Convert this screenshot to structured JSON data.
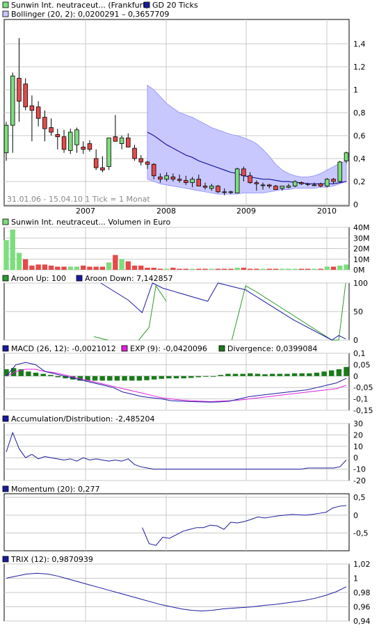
{
  "colors": {
    "up": "#7ddd7d",
    "down": "#e64a4a",
    "band": "#c8c8ff",
    "band_edge": "#8c8cff",
    "sma": "#1a1aa0",
    "aroon_up": "#2a9a2a",
    "aroon_down": "#1a1aa0",
    "macd": "#1a1aa0",
    "exp": "#dd22dd",
    "divergence": "#1a7a1a",
    "line": "#1a1aa0"
  },
  "legend": {
    "price_series": "Sunwin Int. neutraceut... (Frankfurt)",
    "gd": "GD 20 Ticks",
    "bollinger": "Bollinger (20, 2): 0,0200291 – 0,3657709",
    "date_info": "31.01.06 - 15.04.10   1 Tick = 1 Monat",
    "volume": "Sunwin Int. neutraceut... Volumen in Euro",
    "aroon_up": "Aroon Up: 100",
    "aroon_down": "Aroon Down: 7,142857",
    "macd": "MACD (26, 12): -0,0021012",
    "exp": "EXP (9): -0,0420096",
    "divergence": "Divergence: 0,0399084",
    "ad": "Accumulation/Distribution: -2,485204",
    "momentum": "Momentum (20): 0,277",
    "trix": "TRIX (12): 0,9870939"
  },
  "chart_data": [
    {
      "type": "candlestick",
      "x_tick_labels": [
        "2007",
        "2008",
        "2009",
        "2010"
      ],
      "y_tick_labels": [
        "0",
        "0,2",
        "0,4",
        "0,6",
        "0,8",
        "1",
        "1,2",
        "1,4"
      ],
      "ylim": [
        0,
        1.6
      ],
      "ohlc": [
        [
          0.45,
          0.72,
          0.38,
          0.69
        ],
        [
          0.69,
          1.15,
          0.45,
          1.12
        ],
        [
          1.1,
          1.45,
          0.72,
          0.9
        ],
        [
          1.05,
          1.1,
          0.82,
          0.85
        ],
        [
          0.86,
          0.95,
          0.55,
          0.82
        ],
        [
          0.85,
          0.9,
          0.68,
          0.75
        ],
        [
          0.76,
          0.82,
          0.55,
          0.66
        ],
        [
          0.67,
          0.75,
          0.6,
          0.63
        ],
        [
          0.61,
          0.66,
          0.48,
          0.59
        ],
        [
          0.59,
          0.65,
          0.45,
          0.48
        ],
        [
          0.47,
          0.66,
          0.44,
          0.63
        ],
        [
          0.52,
          0.67,
          0.45,
          0.65
        ],
        [
          0.5,
          0.55,
          0.44,
          0.48
        ],
        [
          0.53,
          0.56,
          0.46,
          0.48
        ],
        [
          0.4,
          0.48,
          0.3,
          0.32
        ],
        [
          0.32,
          0.42,
          0.28,
          0.3
        ],
        [
          0.33,
          0.58,
          0.3,
          0.58
        ],
        [
          0.59,
          0.78,
          0.55,
          0.55
        ],
        [
          0.53,
          0.6,
          0.48,
          0.58
        ],
        [
          0.58,
          0.62,
          0.5,
          0.5
        ],
        [
          0.49,
          0.52,
          0.38,
          0.4
        ],
        [
          0.4,
          0.43,
          0.34,
          0.37
        ],
        [
          0.37,
          0.38,
          0.31,
          0.35
        ],
        [
          0.35,
          0.36,
          0.22,
          0.25
        ],
        [
          0.24,
          0.27,
          0.19,
          0.22
        ],
        [
          0.22,
          0.28,
          0.2,
          0.25
        ],
        [
          0.24,
          0.27,
          0.2,
          0.22
        ],
        [
          0.22,
          0.26,
          0.19,
          0.21
        ],
        [
          0.21,
          0.25,
          0.17,
          0.19
        ],
        [
          0.19,
          0.24,
          0.15,
          0.22
        ],
        [
          0.22,
          0.26,
          0.16,
          0.16
        ],
        [
          0.16,
          0.19,
          0.13,
          0.15
        ],
        [
          0.14,
          0.18,
          0.12,
          0.16
        ],
        [
          0.16,
          0.17,
          0.1,
          0.11
        ],
        [
          0.11,
          0.14,
          0.08,
          0.11
        ],
        [
          0.11,
          0.12,
          0.09,
          0.11
        ],
        [
          0.1,
          0.32,
          0.1,
          0.31
        ],
        [
          0.31,
          0.33,
          0.2,
          0.25
        ],
        [
          0.25,
          0.28,
          0.18,
          0.19
        ],
        [
          0.19,
          0.21,
          0.12,
          0.18
        ],
        [
          0.17,
          0.19,
          0.13,
          0.17
        ],
        [
          0.17,
          0.18,
          0.14,
          0.16
        ],
        [
          0.16,
          0.17,
          0.13,
          0.13
        ],
        [
          0.14,
          0.16,
          0.12,
          0.16
        ],
        [
          0.15,
          0.18,
          0.14,
          0.16
        ],
        [
          0.16,
          0.21,
          0.15,
          0.2
        ],
        [
          0.19,
          0.2,
          0.17,
          0.18
        ],
        [
          0.18,
          0.19,
          0.16,
          0.18
        ],
        [
          0.17,
          0.19,
          0.16,
          0.17
        ],
        [
          0.18,
          0.19,
          0.15,
          0.16
        ],
        [
          0.16,
          0.23,
          0.15,
          0.22
        ],
        [
          0.22,
          0.23,
          0.18,
          0.2
        ],
        [
          0.2,
          0.38,
          0.19,
          0.37
        ],
        [
          0.38,
          0.46,
          0.36,
          0.45
        ]
      ],
      "bollinger_upper": [
        1.04,
        1.0,
        0.94,
        0.88,
        0.84,
        0.8,
        0.78,
        0.76,
        0.73,
        0.7,
        0.67,
        0.65,
        0.63,
        0.61,
        0.6,
        0.58,
        0.56,
        0.53,
        0.48,
        0.42,
        0.35,
        0.3,
        0.27,
        0.25,
        0.24,
        0.24,
        0.25,
        0.27,
        0.3,
        0.33,
        0.36,
        0.38
      ],
      "bollinger_lower": [
        0.22,
        0.2,
        0.18,
        0.17,
        0.16,
        0.15,
        0.14,
        0.13,
        0.12,
        0.11,
        0.1,
        0.09,
        0.09,
        0.09,
        0.09,
        0.1,
        0.1,
        0.1,
        0.1,
        0.11,
        0.12,
        0.13,
        0.13,
        0.14,
        0.14,
        0.14,
        0.14,
        0.15,
        0.15,
        0.16,
        0.18,
        0.2
      ],
      "gd20": [
        0.63,
        0.6,
        0.56,
        0.52,
        0.49,
        0.46,
        0.43,
        0.41,
        0.38,
        0.36,
        0.34,
        0.32,
        0.3,
        0.28,
        0.27,
        0.25,
        0.24,
        0.23,
        0.22,
        0.22,
        0.21,
        0.2,
        0.2,
        0.19,
        0.19,
        0.18,
        0.18,
        0.18,
        0.18,
        0.18,
        0.19,
        0.2
      ]
    },
    {
      "type": "bar",
      "title": "Volumen in Euro",
      "y_tick_labels": [
        "0M",
        "10M",
        "20M",
        "30M",
        "40M"
      ],
      "ylim": [
        0,
        40
      ],
      "values": [
        28,
        38,
        16,
        10,
        4,
        5,
        5,
        4,
        3,
        3,
        3,
        3,
        4,
        3,
        3,
        3,
        7,
        14,
        10,
        8,
        4,
        4,
        2,
        2,
        1,
        1,
        2,
        1,
        1,
        1,
        1,
        1,
        1,
        1,
        1,
        1,
        2,
        2,
        1,
        1,
        1,
        1,
        1,
        1,
        1,
        1,
        1,
        1,
        1,
        1,
        3,
        3,
        4,
        5
      ],
      "up": [
        1,
        1,
        1,
        0,
        0,
        0,
        0,
        0,
        0,
        0,
        1,
        1,
        0,
        0,
        0,
        0,
        1,
        0,
        1,
        0,
        0,
        0,
        0,
        0,
        0,
        1,
        0,
        0,
        0,
        1,
        0,
        0,
        1,
        0,
        0,
        0,
        1,
        0,
        0,
        0,
        1,
        0,
        0,
        1,
        1,
        1,
        0,
        0,
        1,
        0,
        1,
        0,
        1,
        1
      ]
    },
    {
      "type": "line",
      "series": [
        {
          "name": "Aroon Up"
        },
        {
          "name": "Aroon Down"
        }
      ],
      "y_tick_labels": [
        "0",
        "50",
        "100"
      ],
      "ylim": [
        0,
        100
      ],
      "aroon_up": [
        [
          0.26,
          6
        ],
        [
          0.3,
          0
        ],
        [
          0.36,
          null
        ],
        [
          0.39,
          0
        ],
        [
          0.42,
          22
        ],
        [
          0.44,
          95
        ],
        [
          0.47,
          68
        ],
        [
          0.6,
          null
        ],
        [
          0.66,
          0
        ],
        [
          0.7,
          95
        ],
        [
          0.73,
          85
        ],
        [
          0.95,
          0
        ],
        [
          0.97,
          0
        ],
        [
          0.99,
          100
        ]
      ],
      "aroon_down": [
        [
          0.28,
          100
        ],
        [
          0.36,
          70
        ],
        [
          0.4,
          48
        ],
        [
          0.43,
          100
        ],
        [
          0.46,
          91
        ],
        [
          0.59,
          68
        ],
        [
          0.62,
          100
        ],
        [
          0.7,
          88
        ],
        [
          0.84,
          35
        ],
        [
          0.95,
          0
        ],
        [
          0.97,
          8
        ],
        [
          0.99,
          2
        ]
      ]
    },
    {
      "type": "line",
      "series": [
        {
          "name": "MACD"
        },
        {
          "name": "EXP"
        },
        {
          "name": "Divergence"
        }
      ],
      "y_tick_labels": [
        "-0,15",
        "-0,1",
        "-0,05",
        "0",
        "0,05",
        "0,1"
      ],
      "ylim": [
        -0.15,
        0.1
      ],
      "macd": [
        0.0,
        0.05,
        0.06,
        0.05,
        0.02,
        0.01,
        0.0,
        -0.01,
        -0.02,
        -0.03,
        -0.04,
        -0.05,
        -0.07,
        -0.08,
        -0.09,
        -0.095,
        -0.1,
        -0.108,
        -0.11,
        -0.112,
        -0.113,
        -0.114,
        -0.113,
        -0.11,
        -0.1,
        -0.09,
        -0.085,
        -0.08,
        -0.075,
        -0.07,
        -0.065,
        -0.06,
        -0.05,
        -0.04,
        -0.03,
        -0.01
      ],
      "exp": [
        0.0,
        0.02,
        0.03,
        0.03,
        0.02,
        0.015,
        0.005,
        -0.005,
        -0.015,
        -0.025,
        -0.035,
        -0.045,
        -0.055,
        -0.065,
        -0.075,
        -0.085,
        -0.095,
        -0.1,
        -0.105,
        -0.108,
        -0.11,
        -0.112,
        -0.11,
        -0.108,
        -0.105,
        -0.1,
        -0.095,
        -0.09,
        -0.085,
        -0.08,
        -0.075,
        -0.07,
        -0.065,
        -0.06,
        -0.055,
        -0.04
      ],
      "divergence": [
        0.03,
        0.035,
        0.03,
        0.02,
        0.015,
        0.01,
        0.005,
        -0.005,
        -0.01,
        -0.015,
        -0.02,
        -0.02,
        -0.02,
        -0.02,
        -0.02,
        -0.02,
        -0.02,
        -0.02,
        -0.02,
        -0.018,
        -0.015,
        -0.012,
        -0.01,
        -0.01,
        -0.01,
        -0.008,
        -0.005,
        -0.003,
        0.0,
        0.005,
        0.01,
        0.01,
        0.01,
        0.012,
        0.01,
        0.008,
        0.01,
        0.01,
        0.01,
        0.012,
        0.012,
        0.012,
        0.015,
        0.02,
        0.025,
        0.03,
        0.04
      ]
    },
    {
      "type": "line",
      "series": [
        {
          "name": "Accumulation/Distribution"
        }
      ],
      "y_tick_labels": [
        "-20",
        "-10",
        "0",
        "10",
        "20",
        "30"
      ],
      "ylim": [
        -20,
        30
      ],
      "values": [
        5,
        22,
        8,
        0,
        3,
        -1,
        1,
        0,
        -1,
        -2,
        -1,
        -3,
        0,
        -2,
        -1,
        -2,
        -3,
        -2,
        -3,
        -1,
        -6,
        -8,
        -9,
        -10,
        -10,
        -10,
        -10,
        -10,
        -10,
        -10,
        -10,
        -10,
        -10,
        -10,
        -10,
        -10,
        -10,
        -10,
        -10,
        -10,
        -10,
        -10,
        -10,
        -10,
        -10,
        -10,
        -10,
        -9,
        -9,
        -9,
        -9,
        -9,
        -8,
        -2
      ]
    },
    {
      "type": "line",
      "series": [
        {
          "name": "Momentum"
        }
      ],
      "y_tick_labels": [
        "-0,5",
        "0",
        "0,5"
      ],
      "ylim": [
        -1.0,
        0.6
      ],
      "values": [
        null,
        null,
        null,
        null,
        null,
        null,
        null,
        null,
        null,
        null,
        null,
        null,
        null,
        null,
        null,
        null,
        null,
        null,
        null,
        null,
        -0.35,
        -0.8,
        -0.85,
        -0.62,
        -0.65,
        -0.55,
        -0.45,
        -0.4,
        -0.35,
        -0.35,
        -0.28,
        -0.3,
        -0.4,
        -0.2,
        -0.22,
        -0.18,
        -0.12,
        -0.05,
        -0.08,
        -0.05,
        -0.02,
        0.0,
        0.02,
        0.01,
        0.0,
        0.02,
        0.05,
        0.08,
        0.2,
        0.25,
        0.27
      ]
    },
    {
      "type": "line",
      "series": [
        {
          "name": "TRIX"
        }
      ],
      "y_tick_labels": [
        "0,94",
        "0,96",
        "0,98",
        "1",
        "1,02"
      ],
      "ylim": [
        0.94,
        1.02
      ],
      "values": [
        1.0,
        1.003,
        1.006,
        1.007,
        1.006,
        1.003,
        0.999,
        0.995,
        0.991,
        0.987,
        0.983,
        0.979,
        0.975,
        0.971,
        0.967,
        0.963,
        0.96,
        0.957,
        0.955,
        0.954,
        0.955,
        0.957,
        0.958,
        0.959,
        0.96,
        0.962,
        0.963,
        0.965,
        0.967,
        0.969,
        0.972,
        0.976,
        0.981,
        0.988
      ]
    }
  ]
}
